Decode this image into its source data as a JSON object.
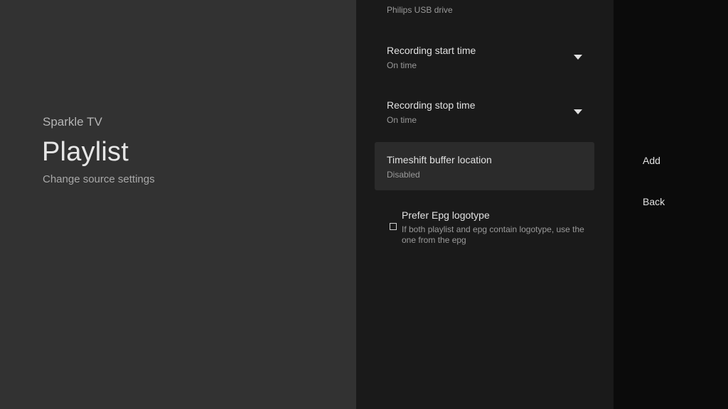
{
  "header": {
    "app_name": "Sparkle TV",
    "title": "Playlist",
    "subtitle": "Change source settings"
  },
  "settings": {
    "storage": {
      "value": "Philips USB drive"
    },
    "recording_start": {
      "title": "Recording start time",
      "value": "On time",
      "icon": "dropdown-arrow-icon"
    },
    "recording_stop": {
      "title": "Recording stop time",
      "value": "On time",
      "icon": "dropdown-arrow-icon"
    },
    "timeshift": {
      "title": "Timeshift buffer location",
      "value": "Disabled"
    },
    "prefer_epg": {
      "title": "Prefer Epg logotype",
      "description": "If both playlist and epg contain logotype, use the one from the epg",
      "checked": false
    }
  },
  "actions": {
    "add_label": "Add",
    "back_label": "Back"
  },
  "colors": {
    "left_panel_bg": "#323232",
    "middle_panel_bg": "#1a1a1a",
    "right_panel_bg": "#0b0b0b",
    "focused_item_bg": "#2b2b2b"
  }
}
